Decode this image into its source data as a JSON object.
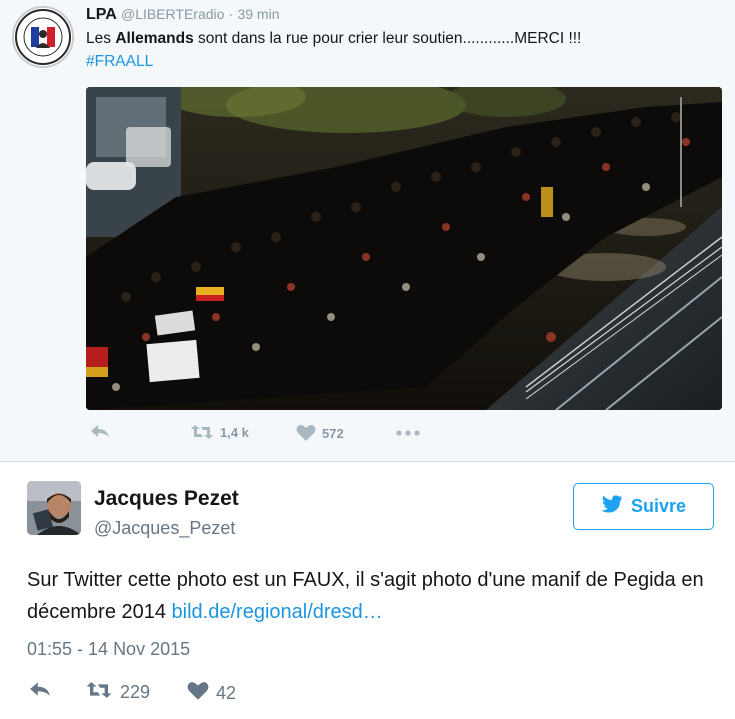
{
  "quoted_tweet": {
    "name": "LPA",
    "handle": "@LIBERTEradio",
    "separator": "·",
    "time": "39 min",
    "text_before": "Les ",
    "text_bold": "Allemands",
    "text_after": " sont dans la rue pour crier leur soutien............MERCI !!!",
    "hashtag": "#FRAALL",
    "photo_icon": "crowd-photo",
    "actions": {
      "reply_icon": "reply-icon",
      "retweet_count": "1,4 k",
      "like_count": "572",
      "more_icon": "more-icon"
    }
  },
  "main_tweet": {
    "name": "Jacques Pezet",
    "handle": "@Jacques_Pezet",
    "follow_label": "Suivre",
    "text": "Sur Twitter cette photo est un FAUX, il s'agit photo d'une manif de Pegida en décembre 2014 ",
    "link": "bild.de/regional/dresd…",
    "date": "01:55 - 14 Nov 2015",
    "actions": {
      "reply_icon": "reply-icon",
      "retweet_count": "229",
      "like_count": "42"
    }
  },
  "colors": {
    "link": "#1b95e0",
    "twitter_blue": "#1da1f2",
    "muted": "#8899a6",
    "card_bg": "#f5f8fa"
  }
}
